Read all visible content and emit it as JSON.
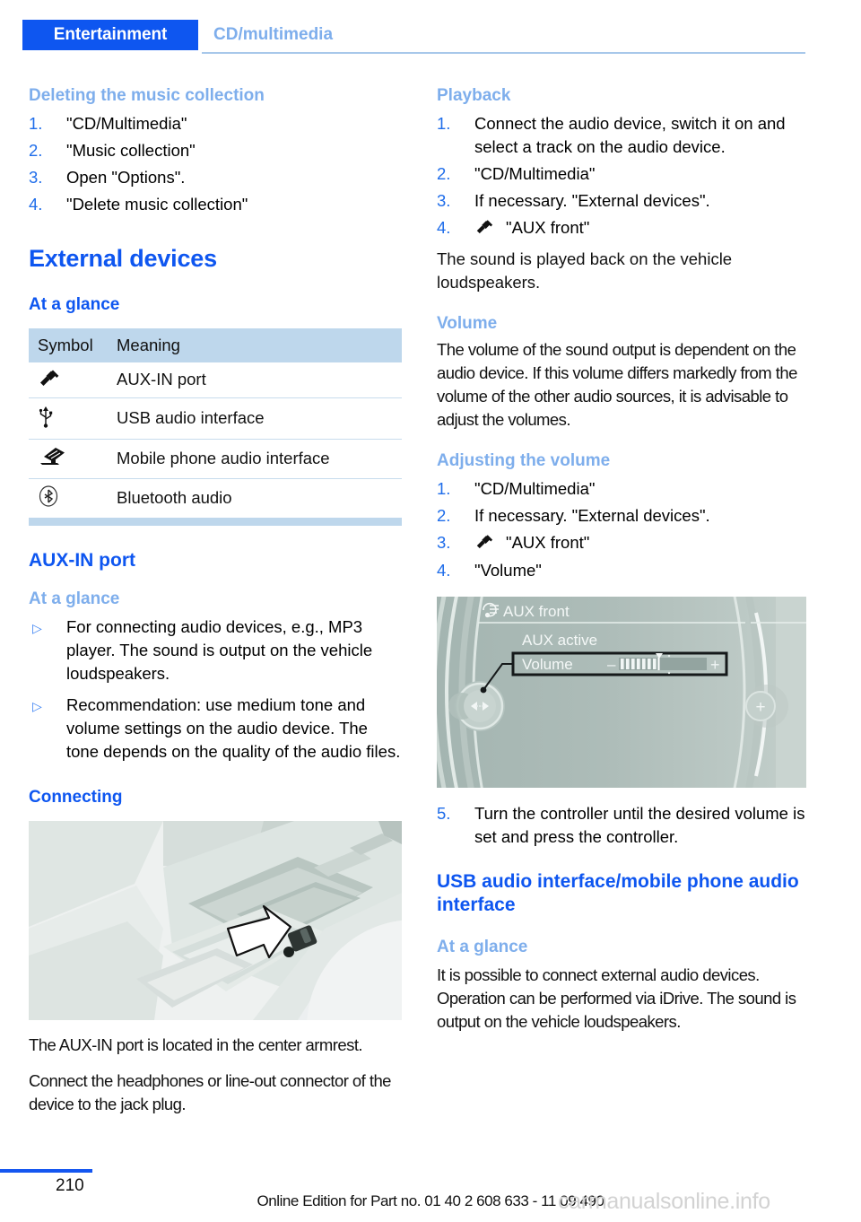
{
  "header": {
    "active_tab": "Entertainment",
    "breadcrumb": "CD/multimedia",
    "accent_color": "#0e56f0",
    "secondary_color": "#7eaeec"
  },
  "left_column": {
    "deleting_heading": "Deleting the music collection",
    "deleting_steps": [
      "\"CD/Multimedia\"",
      "\"Music collection\"",
      "Open \"Options\".",
      "\"Delete music collection\""
    ],
    "external_devices_title": "External devices",
    "at_a_glance_heading": "At a glance",
    "symbol_table": {
      "columns": [
        "Symbol",
        "Meaning"
      ],
      "rows": [
        {
          "icon": "aux-jack-plug-icon",
          "meaning": "AUX-IN port"
        },
        {
          "icon": "usb-icon",
          "meaning": "USB audio interface"
        },
        {
          "icon": "mobile-phone-dock-icon",
          "meaning": "Mobile phone audio interface"
        },
        {
          "icon": "bluetooth-icon",
          "meaning": "Bluetooth audio"
        }
      ]
    },
    "aux_in_port_title": "AUX-IN port",
    "aux_at_a_glance_heading": "At a glance",
    "aux_bullets": [
      "For connecting audio devices, e.g., MP3 player. The sound is output on the vehicle loudspeakers.",
      "Recommendation: use medium tone and volume settings on the audio device. The tone depends on the quality of the audio files."
    ],
    "connecting_heading": "Connecting",
    "console_figure_caption": "The AUX-IN port is located in the center armrest.",
    "connect_paragraph": "Connect the headphones or line-out connector of the device to the jack plug."
  },
  "right_column": {
    "playback_heading": "Playback",
    "playback_steps": [
      {
        "text": "Connect the audio device, switch it on and select a track on the audio device."
      },
      {
        "text": "\"CD/Multimedia\""
      },
      {
        "text": "If necessary. \"External devices\"."
      },
      {
        "icon": "aux-jack-plug-icon",
        "text": "\"AUX front\""
      }
    ],
    "playback_note": "The sound is played back on the vehicle loudspeakers.",
    "volume_heading": "Volume",
    "volume_paragraph": "The volume of the sound output is dependent on the audio device. If this volume differs markedly from the volume of the other audio sources, it is advisable to adjust the volumes.",
    "adjusting_heading": "Adjusting the volume",
    "adjusting_steps": [
      {
        "text": "\"CD/Multimedia\""
      },
      {
        "text": "If necessary. \"External devices\"."
      },
      {
        "icon": "aux-jack-plug-icon",
        "text": "\"AUX front\""
      },
      {
        "text": "\"Volume\""
      }
    ],
    "idrive_screen": {
      "menu_icon": "multimedia-note-icon",
      "title": "AUX front",
      "status_label": "AUX active",
      "volume_label": "Volume",
      "minus_label": "–",
      "plus_label": "+",
      "volume_filled_segments": 7,
      "volume_total_segments": 15,
      "right_plus_label": "+"
    },
    "step5": {
      "num": "5.",
      "text": "Turn the controller until the desired volume is set and press the controller."
    },
    "usb_title": "USB audio interface/mobile phone audio interface",
    "usb_at_a_glance_heading": "At a glance",
    "usb_paragraph": "It is possible to connect external audio devices. Operation can be performed via iDrive. The sound is output on the vehicle loudspeakers."
  },
  "footer": {
    "page_number": "210",
    "edition": "Online Edition for Part no. 01 40 2 608 633 - 11 09 490",
    "watermark": "carmanualsonline.info"
  }
}
